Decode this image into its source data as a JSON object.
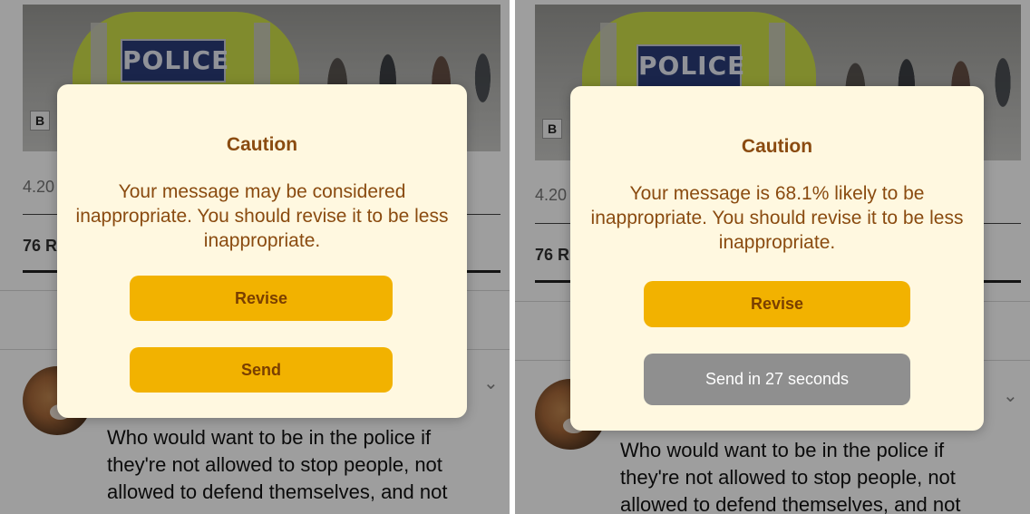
{
  "left": {
    "stats_partial": "4.20",
    "count_partial": "76 R",
    "dialog": {
      "title": "Caution",
      "message": "Your message may be considered inappropriate. You should revise it to be less inappropriate.",
      "revise_label": "Revise",
      "send_label": "Send"
    },
    "comment_text": "Who would want to be in the police if they're not allowed to stop people, not allowed to defend themselves, and not"
  },
  "right": {
    "stats_partial": "4.20",
    "count_partial": "76 R",
    "dialog": {
      "title": "Caution",
      "message": "Your message is 68.1% likely to be inappropriate. You should revise it to be less inappropriate.",
      "revise_label": "Revise",
      "send_label": "Send in 27 seconds"
    },
    "comment_text": "Who would want to be in the police if they're not allowed to stop people, not allowed to defend themselves, and not"
  },
  "photo": {
    "badge_text": "POLICE",
    "source_letter": "B"
  },
  "icons": {
    "chevron": "chevron-down-icon"
  },
  "colors": {
    "dialog_bg": "#fff8e0",
    "dialog_text": "#8a4b10",
    "button_primary": "#f2b200",
    "button_disabled": "#8f8f8f"
  }
}
